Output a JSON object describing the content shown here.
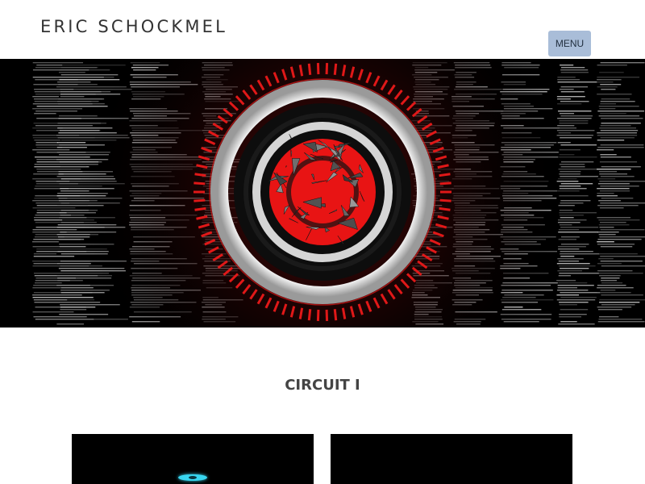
{
  "header": {
    "site_title": "ERIC SCHOCKMEL",
    "menu_label": "MENU"
  },
  "main": {
    "section_title": "CIRCUIT I"
  },
  "colors": {
    "menu_button": "#a9bdd8",
    "accent_red": "#e01818",
    "text": "#333333"
  },
  "hero": {
    "icon": "circuit-target-artwork"
  }
}
